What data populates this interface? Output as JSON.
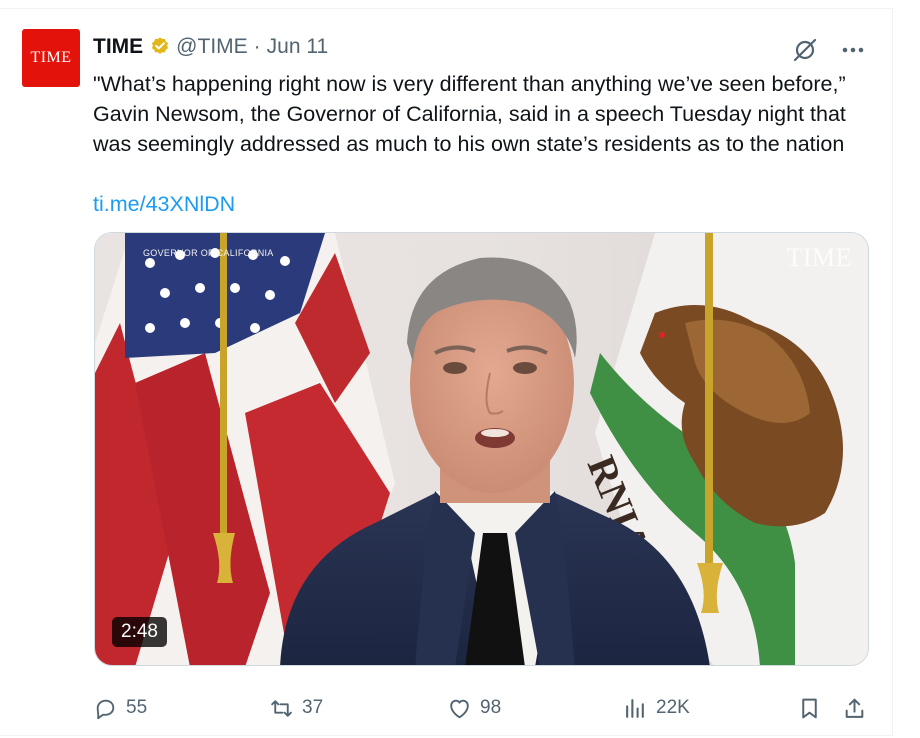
{
  "tweet": {
    "avatar_text": "TIME",
    "author_name": "TIME",
    "handle": "@TIME",
    "separator": "·",
    "date": "Jun 11",
    "text": "\"What’s happening right now is very different than anything we’ve seen before,” Gavin Newsom, the Governor of California, said in a speech Tuesday night that was seemingly addressed as much to his own state’s residents as to the nation",
    "link": "ti.me/43XNlDN"
  },
  "media": {
    "caption": "GOVERNOR OF CALIFORNIA",
    "watermark": "TIME",
    "duration": "2:48"
  },
  "actions": {
    "replies": "55",
    "reposts": "37",
    "likes": "98",
    "views": "22K"
  },
  "colors": {
    "accent": "#1d9bf0",
    "brand": "#e3120b",
    "muted": "#536471",
    "verified": "#e2b719"
  },
  "icons": [
    "verified-badge-icon",
    "grok-icon",
    "more-icon",
    "reply-icon",
    "repost-icon",
    "like-icon",
    "views-icon",
    "bookmark-icon",
    "share-icon"
  ]
}
